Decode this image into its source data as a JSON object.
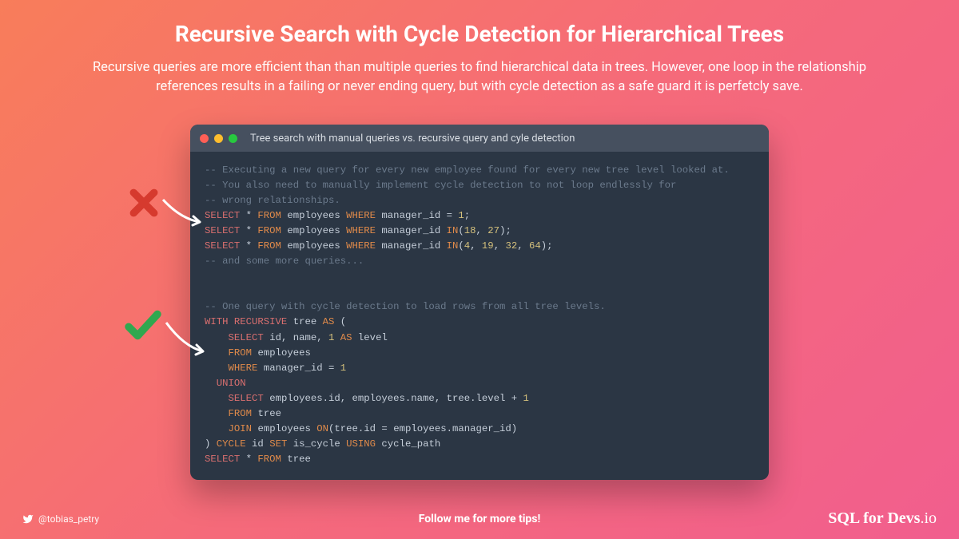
{
  "title": "Recursive Search with Cycle Detection for Hierarchical Trees",
  "subtitle": "Recursive queries are more efficient than than multiple queries to find hierarchical data in trees. However, one loop in the relationship references results in a failing or never ending query, but with cycle detection as a safe guard it is perfetcly save.",
  "window": {
    "title": "Tree search with manual queries vs. recursive query and cyle detection"
  },
  "code": {
    "c1": "-- Executing a new query for every new employee found for every new tree level looked at.",
    "c2": "-- You also need to manually implement cycle detection to not loop endlessly for",
    "c3": "-- wrong relationships.",
    "l1a": "SELECT",
    "l1b": " * ",
    "l1c": "FROM",
    "l1d": " employees ",
    "l1e": "WHERE",
    "l1f": " manager_id = ",
    "l1g": "1",
    "l1h": ";",
    "l2a": "SELECT",
    "l2b": " * ",
    "l2c": "FROM",
    "l2d": " employees ",
    "l2e": "WHERE",
    "l2f": " manager_id ",
    "l2g": "IN",
    "l2h": "(",
    "l2i": "18",
    "l2j": ", ",
    "l2k": "27",
    "l2l": ");",
    "l3a": "SELECT",
    "l3b": " * ",
    "l3c": "FROM",
    "l3d": " employees ",
    "l3e": "WHERE",
    "l3f": " manager_id ",
    "l3g": "IN",
    "l3h": "(",
    "l3i": "4",
    "l3j": ", ",
    "l3k": "19",
    "l3l": ", ",
    "l3m": "32",
    "l3n": ", ",
    "l3o": "64",
    "l3p": ");",
    "c4": "-- and some more queries...",
    "c5": "-- One query with cycle detection to load rows from all tree levels.",
    "r1a": "WITH RECURSIVE",
    "r1b": " tree ",
    "r1c": "AS",
    "r1d": " (",
    "r2a": "    ",
    "r2b": "SELECT",
    "r2c": " id, name, ",
    "r2d": "1",
    "r2e": " ",
    "r2f": "AS",
    "r2g": " level",
    "r3a": "    ",
    "r3b": "FROM",
    "r3c": " employees",
    "r4a": "    ",
    "r4b": "WHERE",
    "r4c": " manager_id = ",
    "r4d": "1",
    "r5a": "  ",
    "r5b": "UNION",
    "r6a": "    ",
    "r6b": "SELECT",
    "r6c": " employees.id, employees.name, tree.level + ",
    "r6d": "1",
    "r7a": "    ",
    "r7b": "FROM",
    "r7c": " tree",
    "r8a": "    ",
    "r8b": "JOIN",
    "r8c": " employees ",
    "r8d": "ON",
    "r8e": "(tree.id = employees.manager_id)",
    "r9a": ") ",
    "r9b": "CYCLE",
    "r9c": " id ",
    "r9d": "SET",
    "r9e": " is_cycle ",
    "r9f": "USING",
    "r9g": " cycle_path",
    "r10a": "SELECT",
    "r10b": " * ",
    "r10c": "FROM",
    "r10d": " tree"
  },
  "footer": {
    "handle": "@tobias_petry",
    "follow": "Follow me for more tips!",
    "brand": "SQL for Devs",
    "brand_ext": ".io"
  }
}
